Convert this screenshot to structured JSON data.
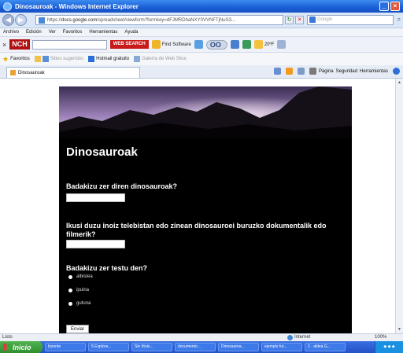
{
  "window": {
    "title": "Dinosauroak - Windows Internet Explorer"
  },
  "address": {
    "scheme": "https://",
    "domain": "docs.google.com",
    "path": "/spreadsheet/viewform?formkey=dFJMRDhaNXY0VVNFTjNuS3...",
    "search_placeholder": "Google"
  },
  "menu": [
    "Archivo",
    "Edición",
    "Ver",
    "Favoritos",
    "Herramientas",
    "Ayuda"
  ],
  "toolbar": {
    "brand": "NCH",
    "websearch": "WEB SEARCH",
    "find_software": "Find Software",
    "temp": "20ºF"
  },
  "favorites": {
    "label": "Favoritos",
    "suggested": "Sitios sugeridos",
    "hotmail": "Hotmail gratuito",
    "gallery": "Galería de Web Slice"
  },
  "tab": {
    "label": "Dinosauroak"
  },
  "commandbar": {
    "page": "Página",
    "safety": "Seguridad",
    "tools": "Herramientas"
  },
  "form": {
    "title": "Dinosauroak",
    "q1": "Badakizu zer diren dinosauroak?",
    "q2": "Ikusi duzu inoiz telebistan edo zinean dinosauroei buruzko dokumentalik edo filmerik?",
    "q3": "Badakizu zer testu den?",
    "options": [
      "albistea",
      "ipuina",
      "gutuna"
    ],
    "submit": "Enviar"
  },
  "status": {
    "left": "Listo",
    "zone": "Internet",
    "zoom": "100%"
  },
  "taskbar": {
    "start": "Inicio",
    "tasks": [
      "bizente",
      "5 Explora...",
      "Sin título...",
      "documento...",
      "Dinosauroa...",
      "ejemplo fut...",
      "2 - aldea G..."
    ]
  },
  "colors": {
    "form_bg": "#000000",
    "titlebar": "#1a5fd6",
    "taskbar": "#2450c8",
    "start": "#3a9a3a"
  }
}
